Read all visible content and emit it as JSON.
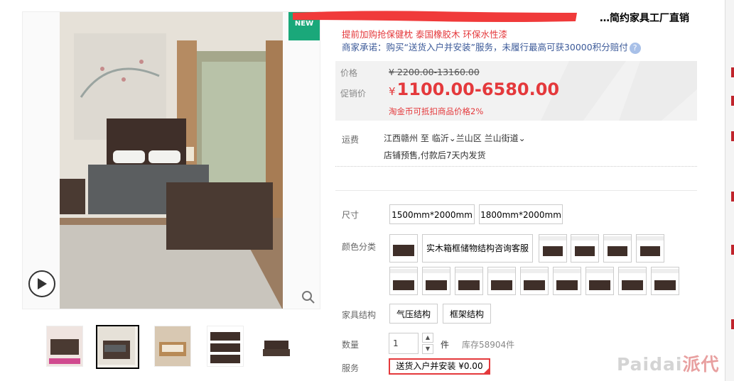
{
  "gallery": {
    "badge": "NEW",
    "play_icon": "play-icon",
    "zoom_icon": "zoom-icon"
  },
  "title": {
    "text": "…简约家具工厂直销"
  },
  "subtitle": "提前加购抢保健枕 泰国橡胶木 环保水性漆",
  "promise": "商家承诺：购买“送货入户并安装”服务，未履行最高可获30000积分赔付",
  "price": {
    "label_price": "价格",
    "original": "¥ 2200.00-13160.00",
    "label_promo": "促销价",
    "currency": "¥",
    "promo": "1100.00-6580.00",
    "coin_note": "淘金币可抵扣商品价格2%"
  },
  "shipping": {
    "label": "运费",
    "from": "江西赣州",
    "to_word": "至",
    "dest_city": "临沂",
    "dest_district": "兰山区",
    "dest_street": "兰山街道",
    "note": "店铺预售,付款后7天内发货"
  },
  "size": {
    "label": "尺寸",
    "options": [
      "1500mm*2000mm",
      "1800mm*2000mm"
    ]
  },
  "color": {
    "label": "颜色分类",
    "text_option": "实木箱框储物结构咨询客服"
  },
  "structure": {
    "label": "家具结构",
    "options": [
      "气压结构",
      "框架结构"
    ]
  },
  "quantity": {
    "label": "数量",
    "value": "1",
    "unit": "件",
    "stock": "库存58904件"
  },
  "service": {
    "label": "服务",
    "option": "送货入户并安装  ¥0.00"
  },
  "watermark": {
    "main": "Paidai",
    "accent": "派代"
  },
  "colors": {
    "accent_red": "#e4393c",
    "link_blue": "#3b5998",
    "new_green": "#1aa87a"
  }
}
